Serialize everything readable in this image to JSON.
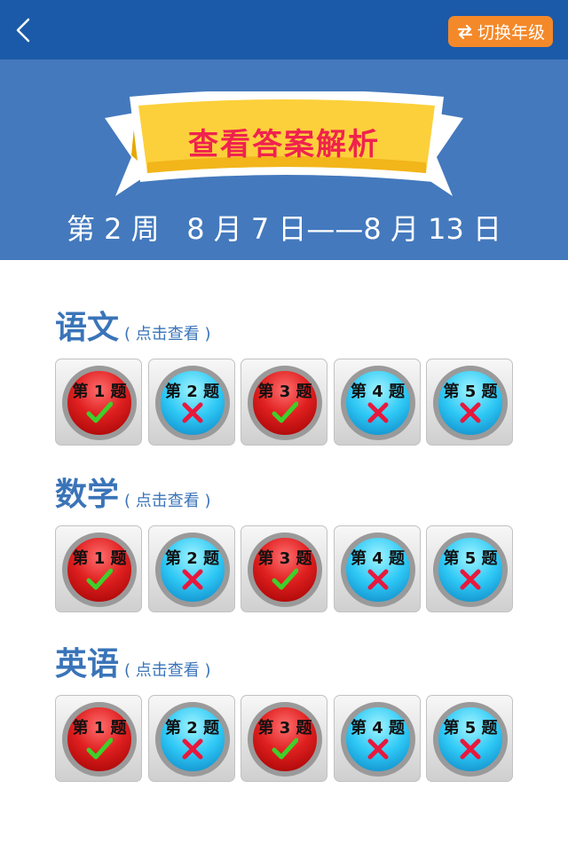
{
  "navbar": {
    "back_icon": "chevron-left-icon",
    "switch_label": "切换年级",
    "switch_icon": "swap-arrows-icon",
    "background": "#1b5aa8",
    "button_color": "#f4892a"
  },
  "banner": {
    "title": "查看答案解析",
    "week": "第 2 周",
    "dates": "8 月 7 日——8 月 13 日",
    "background": "#4479bd"
  },
  "subjects": [
    {
      "name": "语文",
      "hint": "( 点击查看 )",
      "questions": [
        {
          "label": "第 1 题",
          "status": "correct"
        },
        {
          "label": "第 2 题",
          "status": "wrong"
        },
        {
          "label": "第 3 题",
          "status": "correct"
        },
        {
          "label": "第 4 题",
          "status": "wrong"
        },
        {
          "label": "第 5 题",
          "status": "wrong"
        }
      ]
    },
    {
      "name": "数学",
      "hint": "( 点击查看 )",
      "questions": [
        {
          "label": "第 1 题",
          "status": "correct"
        },
        {
          "label": "第 2 题",
          "status": "wrong"
        },
        {
          "label": "第 3 题",
          "status": "correct"
        },
        {
          "label": "第 4 题",
          "status": "wrong"
        },
        {
          "label": "第 5 题",
          "status": "wrong"
        }
      ]
    },
    {
      "name": "英语",
      "hint": "( 点击查看 )",
      "questions": [
        {
          "label": "第 1 题",
          "status": "correct"
        },
        {
          "label": "第 2 题",
          "status": "wrong"
        },
        {
          "label": "第 3 题",
          "status": "correct"
        },
        {
          "label": "第 4 题",
          "status": "wrong"
        },
        {
          "label": "第 5 题",
          "status": "wrong"
        }
      ]
    }
  ],
  "colors": {
    "subject_text": "#3a74b8",
    "title_text": "#f0224e",
    "correct": "#e02020",
    "wrong": "#2ec8f5"
  }
}
